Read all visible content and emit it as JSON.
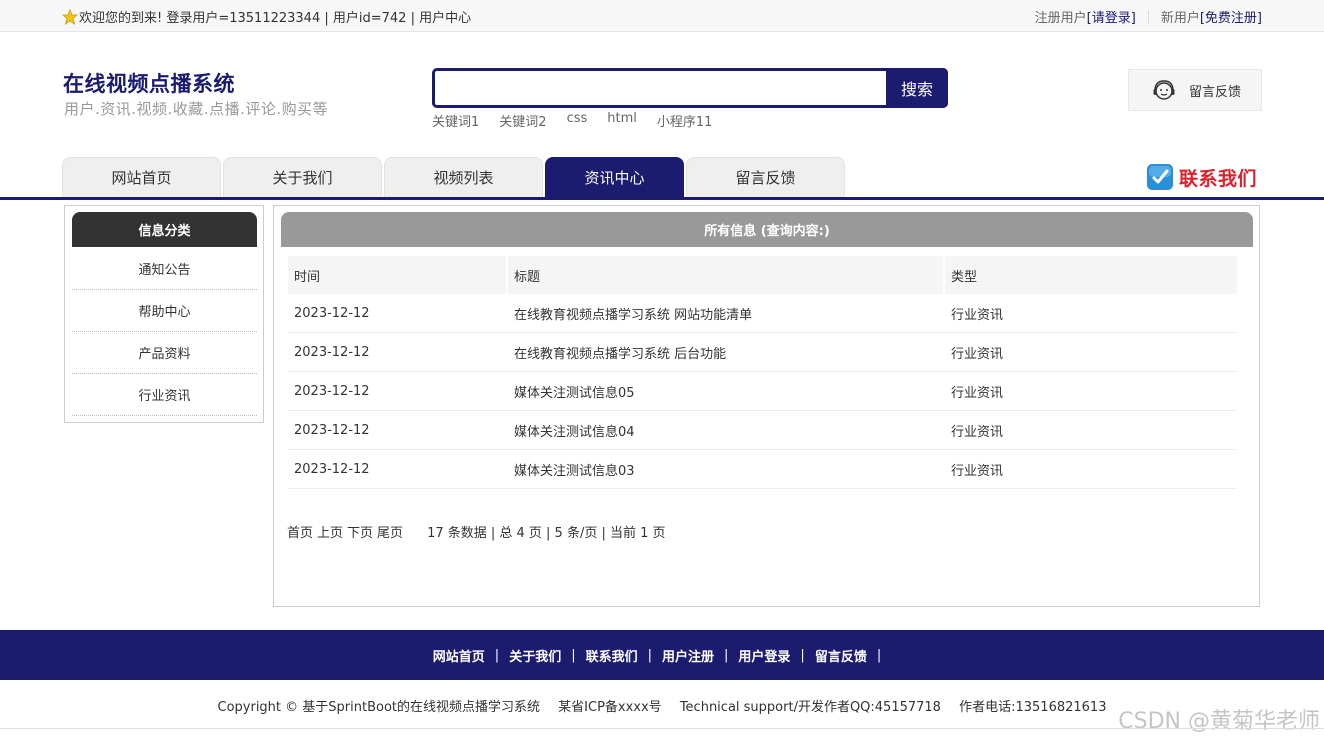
{
  "topbar": {
    "welcome": "欢迎您的到来!  登录用户=13511223344 | 用户id=742 | 用户中心",
    "registered_label": "注册用户 ",
    "login_link": "[请登录]",
    "new_user_label": "新用户 ",
    "register_link": "[免费注册]"
  },
  "header": {
    "site_title": "在线视频点播系统",
    "site_subtitle": "用户.资讯.视频.收藏.点播.评论.购买等",
    "search": {
      "value": "",
      "placeholder": "",
      "button": "搜索"
    },
    "keywords": [
      "关键词1",
      "关键词2",
      "css",
      "html",
      "小程序11"
    ],
    "feedback_button": "留言反馈"
  },
  "nav": {
    "tabs": [
      "网站首页",
      "关于我们",
      "视频列表",
      "资讯中心",
      "留言反馈"
    ],
    "active_tab": "资讯中心",
    "contact": "联系我们"
  },
  "sidebar": {
    "title": "信息分类",
    "items": [
      "通知公告",
      "帮助中心",
      "产品资料",
      "行业资讯"
    ]
  },
  "main": {
    "title": "所有信息 (查询内容:)",
    "columns": [
      "时间",
      "标题",
      "类型"
    ],
    "rows": [
      [
        "2023-12-12",
        "在线教育视频点播学习系统 网站功能清单",
        "行业资讯"
      ],
      [
        "2023-12-12",
        "在线教育视频点播学习系统 后台功能",
        "行业资讯"
      ],
      [
        "2023-12-12",
        "媒体关注测试信息05",
        "行业资讯"
      ],
      [
        "2023-12-12",
        "媒体关注测试信息04",
        "行业资讯"
      ],
      [
        "2023-12-12",
        "媒体关注测试信息03",
        "行业资讯"
      ]
    ],
    "pager": {
      "first": "首页",
      "prev": "上页",
      "next": "下页",
      "last": "尾页",
      "info": "17 条数据 | 总 4 页 | 5 条/页 | 当前 1 页"
    }
  },
  "footer": {
    "links": [
      "网站首页",
      "关于我们",
      "联系我们",
      "用户注册",
      "用户登录",
      "留言反馈"
    ],
    "copyright": "Copyright © 基于SprintBoot的在线视频点播学习系统",
    "icp": "某省ICP备xxxx号",
    "support": "Technical support/开发作者QQ:45157718",
    "phone": "作者电话:13516821613",
    "watermark": "CSDN @黄菊华老师"
  },
  "colors": {
    "brand": "#1b1b6f",
    "accent_red": "#e0202b"
  }
}
